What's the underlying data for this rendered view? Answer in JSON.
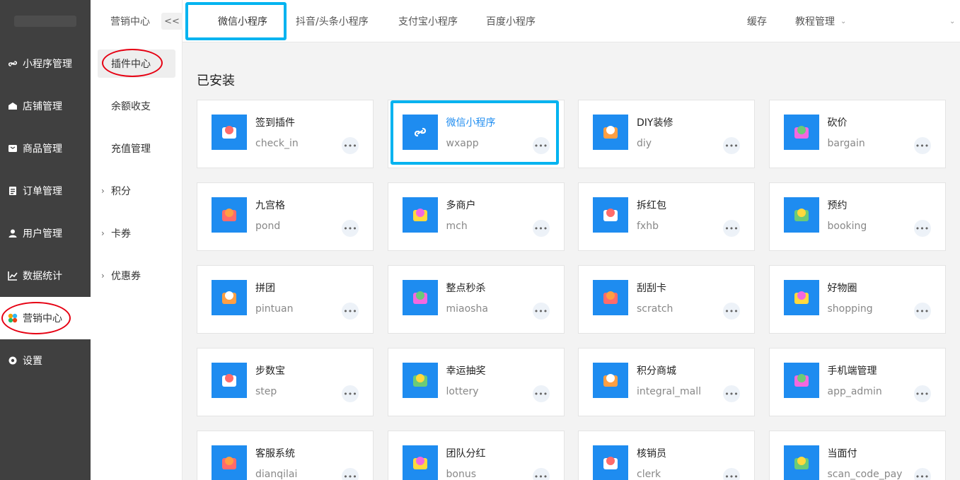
{
  "sidebar": {
    "items": [
      {
        "label": "小程序管理",
        "icon": "link-icon"
      },
      {
        "label": "店铺管理",
        "icon": "store-icon"
      },
      {
        "label": "商品管理",
        "icon": "goods-icon"
      },
      {
        "label": "订单管理",
        "icon": "order-icon"
      },
      {
        "label": "用户管理",
        "icon": "user-icon"
      },
      {
        "label": "数据统计",
        "icon": "chart-icon"
      },
      {
        "label": "营销中心",
        "icon": "marketing-icon"
      },
      {
        "label": "设置",
        "icon": "gear-icon"
      }
    ],
    "active": "营销中心"
  },
  "subnav": {
    "title": "营销中心",
    "collapse_label": "<<",
    "items": [
      {
        "label": "插件中心"
      },
      {
        "label": "余额收支"
      },
      {
        "label": "充值管理"
      },
      {
        "label": "积分"
      },
      {
        "label": "卡券"
      },
      {
        "label": "优惠券"
      }
    ]
  },
  "header": {
    "tabs": [
      {
        "label": "微信小程序"
      },
      {
        "label": "抖音/头条小程序"
      },
      {
        "label": "支付宝小程序"
      },
      {
        "label": "百度小程序"
      }
    ],
    "cache_label": "缓存",
    "tutorial_label": "教程管理"
  },
  "main": {
    "section_title": "已安装",
    "more_label": "•••",
    "plugins": [
      {
        "name": "签到插件",
        "code": "check_in"
      },
      {
        "name": "微信小程序",
        "code": "wxapp"
      },
      {
        "name": "DIY装修",
        "code": "diy"
      },
      {
        "name": "砍价",
        "code": "bargain"
      },
      {
        "name": "九宫格",
        "code": "pond"
      },
      {
        "name": "多商户",
        "code": "mch"
      },
      {
        "name": "拆红包",
        "code": "fxhb"
      },
      {
        "name": "预约",
        "code": "booking"
      },
      {
        "name": "拼团",
        "code": "pintuan"
      },
      {
        "name": "整点秒杀",
        "code": "miaosha"
      },
      {
        "name": "刮刮卡",
        "code": "scratch"
      },
      {
        "name": "好物圈",
        "code": "shopping"
      },
      {
        "name": "步数宝",
        "code": "step"
      },
      {
        "name": "幸运抽奖",
        "code": "lottery"
      },
      {
        "name": "积分商城",
        "code": "integral_mall"
      },
      {
        "name": "手机端管理",
        "code": "app_admin"
      },
      {
        "name": "客服系统",
        "code": "dianqilai"
      },
      {
        "name": "团队分红",
        "code": "bonus"
      },
      {
        "name": "核销员",
        "code": "clerk"
      },
      {
        "name": "当面付",
        "code": "scan_code_pay"
      }
    ]
  },
  "colors": {
    "sidebar_bg": "#404040",
    "accent": "#1e8cf0",
    "highlight_box": "#00b3f0",
    "annotation_red": "#e60012"
  }
}
